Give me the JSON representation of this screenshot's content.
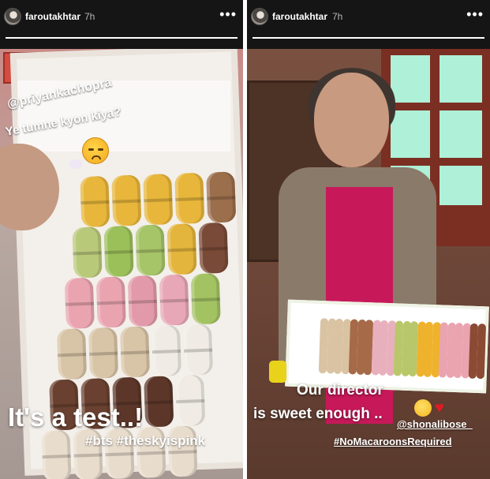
{
  "stories": [
    {
      "username": "faroutakhtar",
      "time": "7h",
      "more_label": "•••",
      "progress_fraction": 1.0,
      "stickers": {
        "mention": "@priyankachopra",
        "line": "Ye tumne kyon kiya?",
        "emoji": "worried-face-emoji"
      },
      "caption": "It's a test..!",
      "hashtags": "#bts #theskyispink"
    },
    {
      "username": "faroutakhtar",
      "time": "7h",
      "more_label": "•••",
      "progress_fraction": 1.0,
      "caption_line1": "Our director",
      "caption_line2": "is sweet enough ..",
      "emojis": [
        "smiling-face-emoji",
        "red-heart-emoji"
      ],
      "mention": "@shonalibose_",
      "hashtag": "#NoMacaroonsRequired"
    }
  ],
  "colors": {
    "header_bg": "#151515",
    "text": "#ffffff",
    "muted_text": "#b8b8b8",
    "divider": "#ffffff"
  }
}
